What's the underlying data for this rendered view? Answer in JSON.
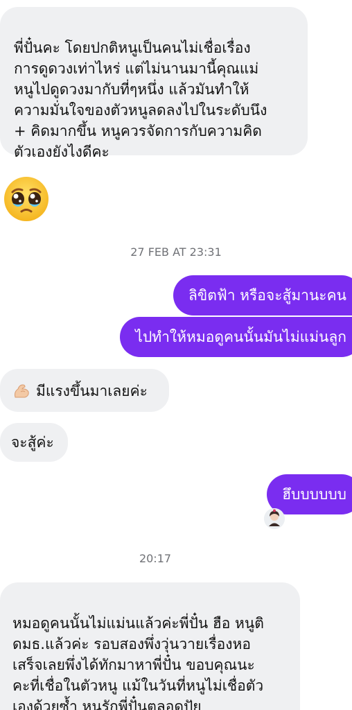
{
  "messages": {
    "incoming_1": "พี่ปั๋นคะ โดยปกติหนูเป็นคนไม่เชื่อเรื่อง\nการดูดวงเท่าไหร่ แต่ไม่นานมานี้คุณแม่\nหนูไปดูดวงมากับที่ๆหนึ่ง แล้วมันทำให้\nความมั่นใจของตัวหนูลดลงไปในระดับนึง\n+ คิดมากขึ้น หนูควรจัดการกับความคิด\nตัวเองยังไงดีคะ",
    "emoji_1": "pleading-face-with-tears",
    "timestamp_1": "27 FEB AT 23:31",
    "outgoing_1": "ลิขิตฟ้า หรือจะสู้มานะคน",
    "outgoing_2": "ไปทำให้หมอดูคนนั้นมันไม่แม่นลูก",
    "incoming_2_icon": "flexed-biceps",
    "incoming_2": "มีแรงขึ้นมาเลยค่ะ",
    "incoming_3": "จะสู้ค่ะ",
    "outgoing_3": "ฮึบบบบบบ",
    "seen_avatar": "user-avatar",
    "timestamp_2": "20:17",
    "incoming_4": "หมอดูคนนั้นไม่แม่นแล้วค่ะพี่ปั๋น ฮือ หนูติ\nดมธ.แล้วค่ะ รอบสองพึ่งวุ่นวายเรื่องหอ\nเสร็จเลยพึ่งได้ทักมาหาพี่ปั๋น ขอบคุณนะ\nคะที่เชื่อในตัวหนู แม้ในวันที่หนูไม่เชื่อตัว\nเองด้วยซ้ำ หนูรักพี่ปั๋นตลอดปัย"
  },
  "colors": {
    "incoming_bg": "#eff0f2",
    "outgoing_bg": "#7a2df0",
    "timestamp": "#6f7176"
  }
}
